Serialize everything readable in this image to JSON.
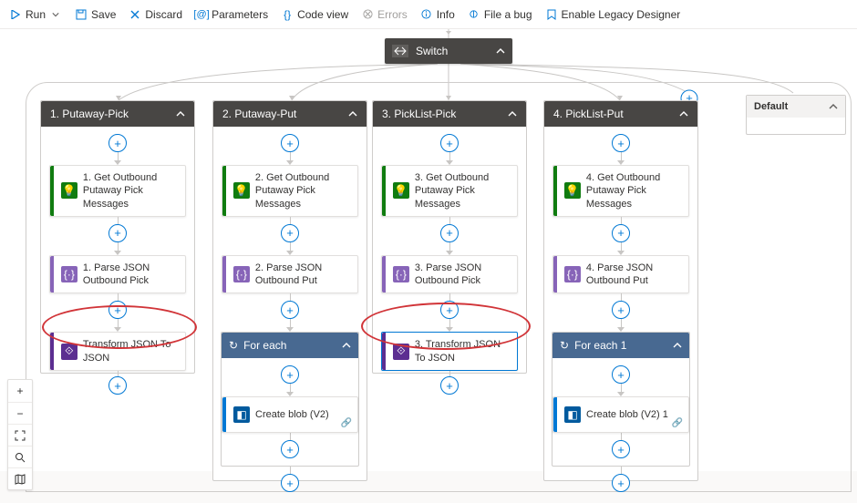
{
  "toolbar": {
    "run": "Run",
    "save": "Save",
    "discard": "Discard",
    "parameters": "Parameters",
    "codeview": "Code view",
    "errors": "Errors",
    "info": "Info",
    "filebug": "File a bug",
    "legacy": "Enable Legacy Designer"
  },
  "switch": {
    "label": "Switch"
  },
  "cases": [
    {
      "title": "1. Putaway-Pick",
      "get": "1. Get Outbound Putaway Pick Messages",
      "parse": "1. Parse JSON Outbound Pick",
      "transform": "Transform JSON To JSON"
    },
    {
      "title": "2. Putaway-Put",
      "get": "2. Get Outbound Putaway Pick Messages",
      "parse": "2. Parse JSON Outbound Put",
      "foreach": "For each",
      "blob": "Create blob (V2)"
    },
    {
      "title": "3. PickList-Pick",
      "get": "3. Get Outbound Putaway Pick Messages",
      "parse": "3. Parse JSON Outbound Pick",
      "transform": "3. Transform JSON To JSON"
    },
    {
      "title": "4. PickList-Put",
      "get": "4. Get Outbound Putaway Pick Messages",
      "parse": "4. Parse JSON Outbound Put",
      "foreach": "For each 1",
      "blob": "Create blob (V2) 1"
    }
  ],
  "default": {
    "label": "Default"
  }
}
